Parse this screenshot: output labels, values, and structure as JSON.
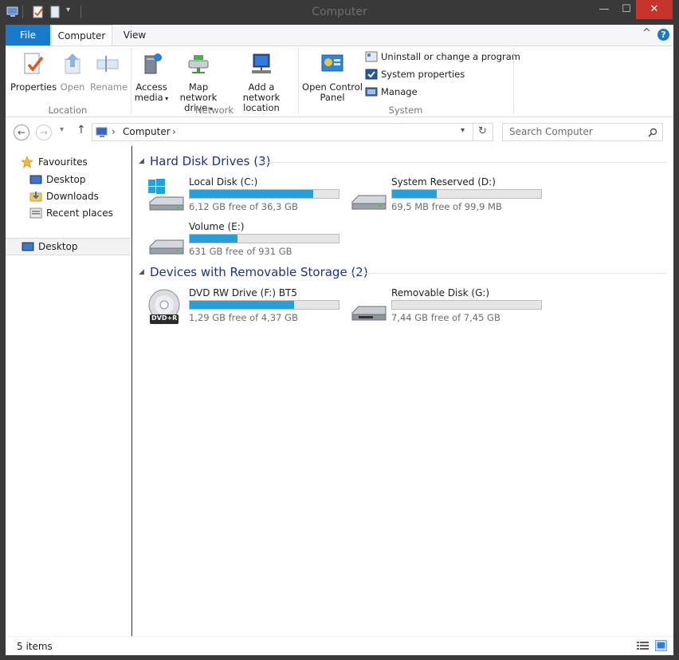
{
  "window": {
    "title": "Computer"
  },
  "title_controls": {
    "minimize": "—",
    "maximize": "☐",
    "close": "✕"
  },
  "tabs": [
    {
      "label": "File"
    },
    {
      "label": "Computer"
    },
    {
      "label": "View"
    }
  ],
  "ribbon_controls": {
    "collapse": "^",
    "help": "?"
  },
  "ribbon": {
    "location": {
      "label": "Location",
      "buttons": [
        {
          "label": "Properties"
        },
        {
          "label": "Open"
        },
        {
          "label": "Rename"
        }
      ]
    },
    "network": {
      "label": "Network",
      "buttons": [
        {
          "line1": "Access",
          "line2": "media"
        },
        {
          "line1": "Map network",
          "line2": "drive"
        },
        {
          "line1": "Add a network",
          "line2": "location"
        }
      ]
    },
    "system": {
      "label": "System",
      "open_cp": {
        "line1": "Open Control",
        "line2": "Panel"
      },
      "small": [
        {
          "label": "Uninstall or change a program"
        },
        {
          "label": "System properties"
        },
        {
          "label": "Manage"
        }
      ]
    }
  },
  "nav": {
    "back": "←",
    "forward": "→",
    "recent": "▾",
    "up": "↑"
  },
  "address": {
    "path": "Computer",
    "sep": "›"
  },
  "search": {
    "placeholder": "Search Computer"
  },
  "sidebar": {
    "favourites": {
      "label": "Favourites",
      "items": [
        {
          "label": "Desktop"
        },
        {
          "label": "Downloads"
        },
        {
          "label": "Recent places"
        }
      ]
    },
    "desktop": {
      "label": "Desktop"
    }
  },
  "groups": [
    {
      "title": "Hard Disk Drives (3)",
      "drives": [
        {
          "name": "Local Disk (C:)",
          "free": "6,12 GB free of 36,3 GB",
          "used_fraction": 0.83
        },
        {
          "name": "System Reserved (D:)",
          "free": "69,5 MB free of 99,9 MB",
          "used_fraction": 0.3
        },
        {
          "name": "Volume (E:)",
          "free": "631 GB free of 931 GB",
          "used_fraction": 0.32
        }
      ]
    },
    {
      "title": "Devices with Removable Storage (2)",
      "drives": [
        {
          "name": "DVD RW Drive (F:) BT5",
          "free": "1,29 GB free of 4,37 GB",
          "used_fraction": 0.7
        },
        {
          "name": "Removable Disk (G:)",
          "free": "7,44 GB free of 7,45 GB",
          "used_fraction": 0.0
        }
      ]
    }
  ],
  "dvd_badge": "DVD+R",
  "status": {
    "items": "5 items"
  },
  "colors": {
    "accent": "#1979ca",
    "bar_fill": "#26a0da",
    "group_title": "#1e3287"
  }
}
